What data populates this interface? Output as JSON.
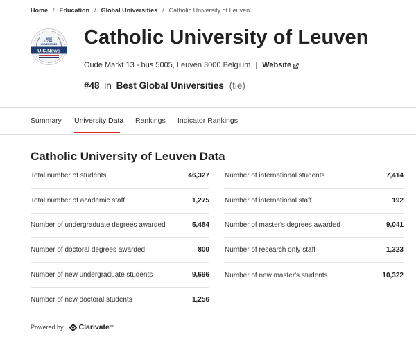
{
  "breadcrumb": [
    {
      "label": "Home"
    },
    {
      "label": "Education"
    },
    {
      "label": "Global Universities"
    },
    {
      "label": "Catholic University of Leuven"
    }
  ],
  "badge": {
    "top_text": "BEST GLOBAL UNIVERSITIES",
    "brand": "U.S.News",
    "icon": "usnews-badge-icon"
  },
  "header": {
    "title": "Catholic University of Leuven",
    "address": "Oude Markt 13 - bus 5005, Leuven 3000 Belgium",
    "website_label": "Website",
    "rank_number": "#48",
    "rank_in": "in",
    "rank_list": "Best Global Universities",
    "rank_tie": "(tie)"
  },
  "tabs": [
    {
      "label": "Summary",
      "active": false
    },
    {
      "label": "University Data",
      "active": true
    },
    {
      "label": "Rankings",
      "active": false
    },
    {
      "label": "Indicator Rankings",
      "active": false
    }
  ],
  "section": {
    "title": "Catholic University of Leuven Data"
  },
  "data_left": [
    {
      "label": "Total number of students",
      "value": "46,327"
    },
    {
      "label": "Total number of academic staff",
      "value": "1,275"
    },
    {
      "label": "Number of undergraduate degrees awarded",
      "value": "5,484"
    },
    {
      "label": "Number of doctoral degrees awarded",
      "value": "800"
    },
    {
      "label": "Number of new undergraduate students",
      "value": "9,696"
    },
    {
      "label": "Number of new doctoral students",
      "value": "1,256"
    }
  ],
  "data_right": [
    {
      "label": "Number of international students",
      "value": "7,414"
    },
    {
      "label": "Number of international staff",
      "value": "192"
    },
    {
      "label": "Number of master's degrees awarded",
      "value": "9,041"
    },
    {
      "label": "Number of research only staff",
      "value": "1,323"
    },
    {
      "label": "Number of new master's students",
      "value": "10,322"
    }
  ],
  "footer": {
    "powered_by": "Powered by",
    "provider": "Clarivate",
    "provider_mark": "™"
  },
  "colors": {
    "accent": "#d62d20",
    "navy": "#1f3a6e",
    "text": "#222222"
  }
}
